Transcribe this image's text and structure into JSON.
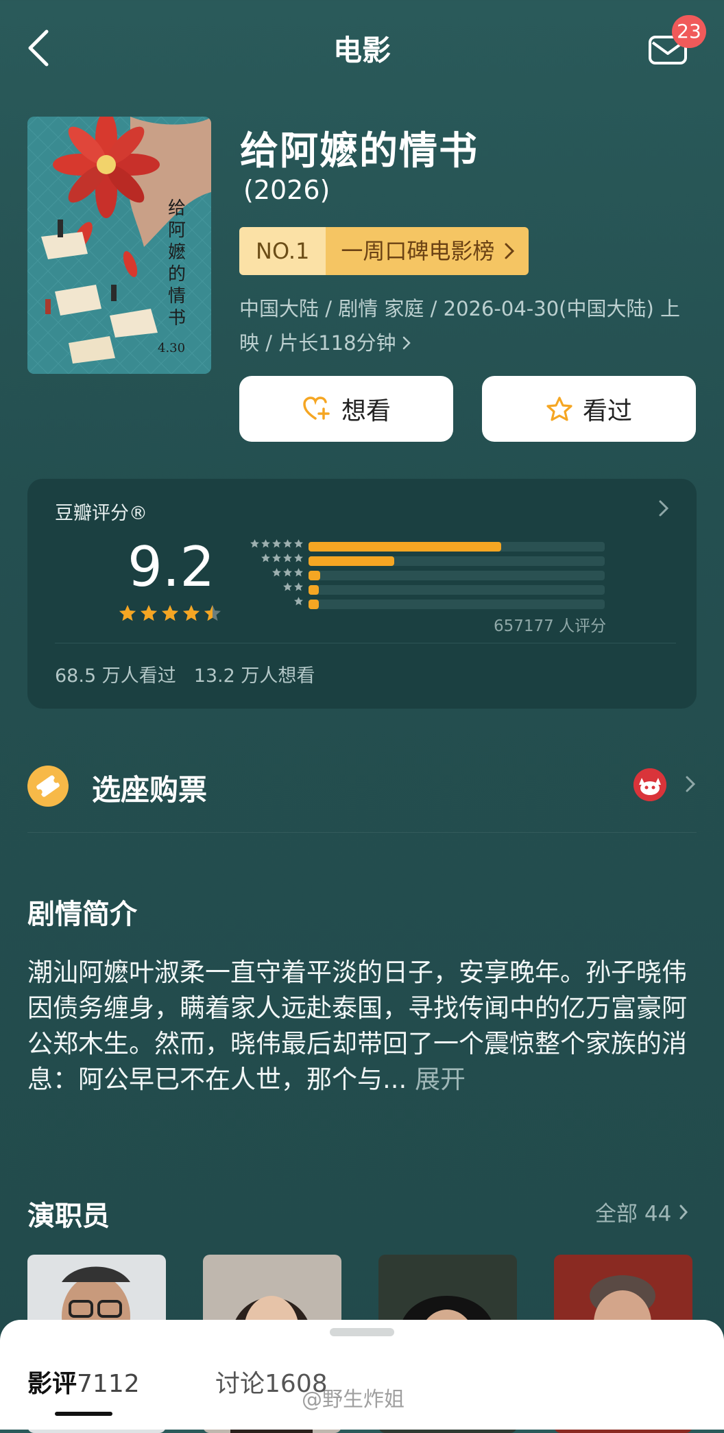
{
  "header": {
    "title": "电影",
    "notification_count": "23"
  },
  "movie": {
    "title": "给阿嬷的情书",
    "year": "(2026)",
    "rank_no": "NO.1",
    "rank_label": "一周口碑电影榜",
    "meta_line1": "中国大陆 / 剧情 家庭 / 2026-04-30(中国大陆) 上",
    "meta_line2": "映 / 片长118分钟",
    "poster_date": "4.30"
  },
  "actions": {
    "want_label": "想看",
    "watched_label": "看过"
  },
  "rating": {
    "brand": "豆瓣评分®",
    "score": "9.2",
    "stars_value": 4.5,
    "distribution": [
      0.65,
      0.29,
      0.04,
      0.03,
      0.03
    ],
    "count_text": "657177 人评分",
    "watched_text": "68.5 万人看过",
    "want_text": "13.2 万人想看"
  },
  "ticket": {
    "label": "选座购票"
  },
  "synopsis": {
    "title": "剧情简介",
    "text": "潮汕阿嬷叶淑柔一直守着平淡的日子，安享晚年。孙子晓伟因债务缠身，瞒着家人远赴泰国，寻找传闻中的亿万富豪阿公郑木生。然而，晓伟最后却带回了一个震惊整个家族的消息：阿公早已不在人世，那个与...",
    "expand_label": "展开"
  },
  "cast": {
    "title": "演职员",
    "all_label": "全部 44"
  },
  "bottom_tabs": {
    "reviews_label": "影评",
    "reviews_count": "7112",
    "discussion_label": "讨论",
    "discussion_count": "1608"
  },
  "watermark": "@野生炸姐",
  "colors": {
    "accent": "#f5a623",
    "badge": "#f05a5a",
    "background": "#244f50"
  }
}
